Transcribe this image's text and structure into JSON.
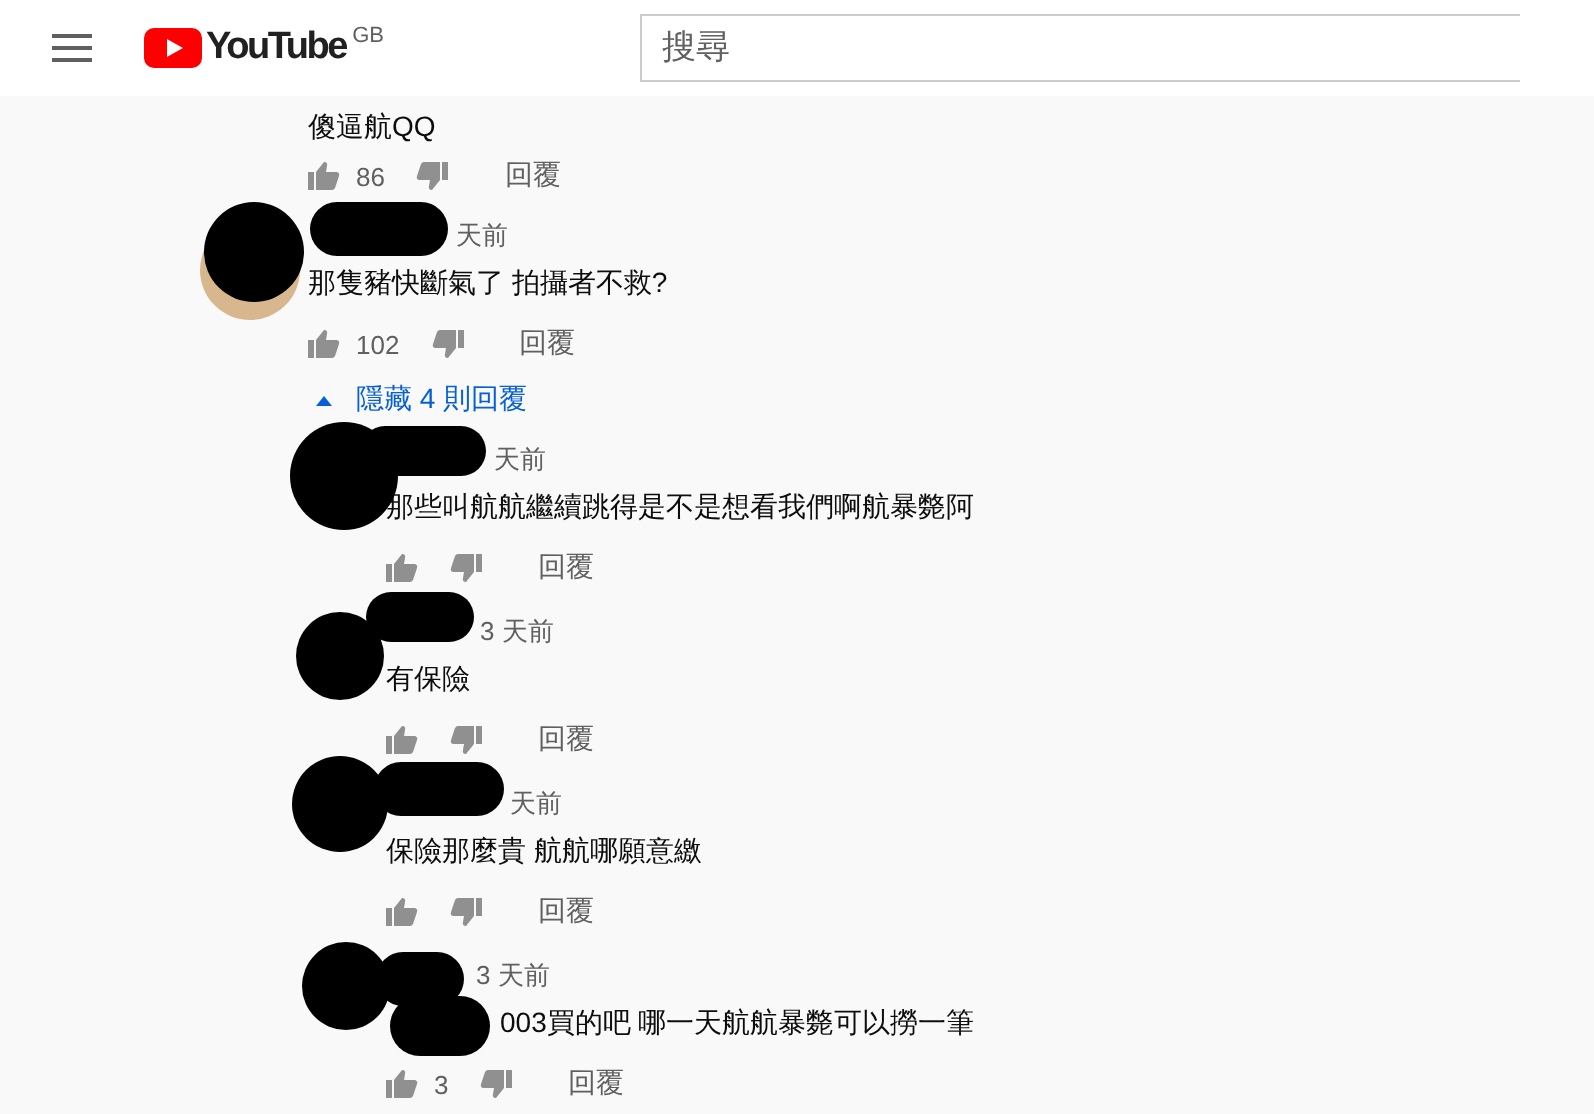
{
  "header": {
    "logo": "YouTube",
    "region": "GB",
    "search": {
      "placeholder": "搜尋"
    }
  },
  "comments": [
    {
      "kind": "comment",
      "text": "傻逼航QQ",
      "likes": "86",
      "reply_label": "回覆"
    },
    {
      "kind": "comment",
      "time": "天前",
      "text": "那隻豬快斷氣了 拍攝者不救?",
      "likes": "102",
      "reply_label": "回覆",
      "redacted": true,
      "replies_toggle": {
        "label": "隱藏 4 則回覆",
        "expanded": true
      },
      "replies": [
        {
          "kind": "reply",
          "time": "天前",
          "text": "那些叫航航繼續跳得是不是想看我們啊航暴斃阿",
          "reply_label": "回覆",
          "redacted": true
        },
        {
          "kind": "reply",
          "time": "3 天前",
          "text": "有保險",
          "reply_label": "回覆",
          "redacted": true
        },
        {
          "kind": "reply",
          "time": "天前",
          "text": "保險那麼貴 航航哪願意繳",
          "reply_label": "回覆",
          "redacted": true
        },
        {
          "kind": "reply",
          "time": "3 天前",
          "text": "003買的吧 哪一天航航暴斃可以撈一筆",
          "likes": "3",
          "reply_label": "回覆",
          "redacted": true
        }
      ]
    }
  ]
}
